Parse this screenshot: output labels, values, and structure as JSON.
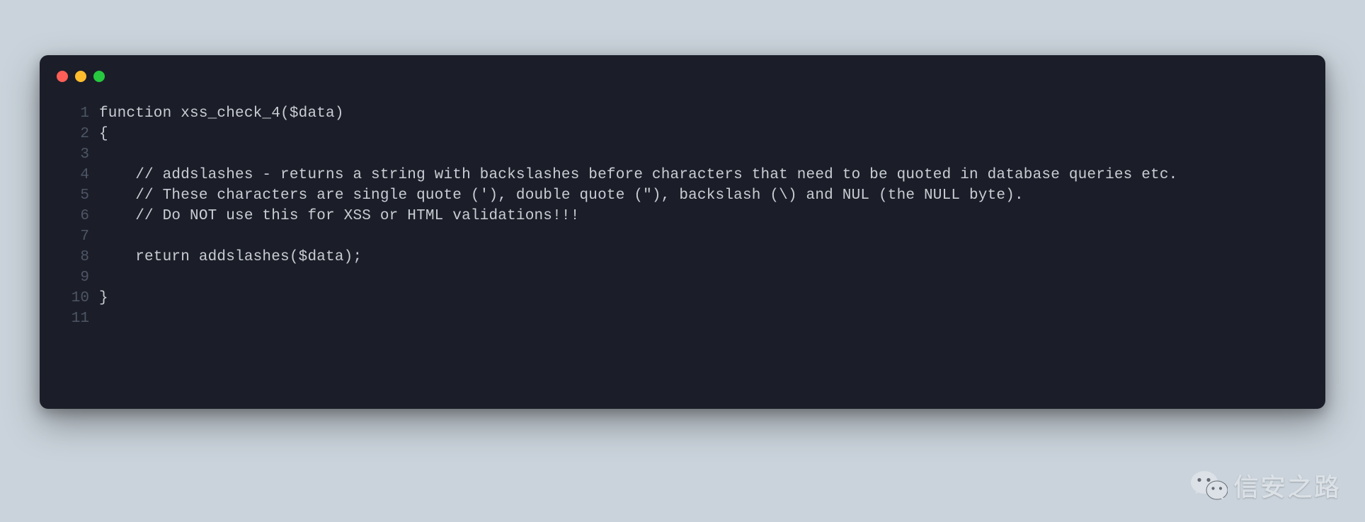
{
  "code": {
    "lines": [
      {
        "num": "1",
        "text": "function xss_check_4($data)"
      },
      {
        "num": "2",
        "text": "{"
      },
      {
        "num": "3",
        "text": ""
      },
      {
        "num": "4",
        "text": "    // addslashes - returns a string with backslashes before characters that need to be quoted in database queries etc."
      },
      {
        "num": "5",
        "text": "    // These characters are single quote ('), double quote (\"), backslash (\\) and NUL (the NULL byte)."
      },
      {
        "num": "6",
        "text": "    // Do NOT use this for XSS or HTML validations!!!"
      },
      {
        "num": "7",
        "text": ""
      },
      {
        "num": "8",
        "text": "    return addslashes($data);"
      },
      {
        "num": "9",
        "text": ""
      },
      {
        "num": "10",
        "text": "}"
      },
      {
        "num": "11",
        "text": ""
      }
    ]
  },
  "watermark": {
    "text": "信安之路",
    "icon": "wechat-icon"
  }
}
